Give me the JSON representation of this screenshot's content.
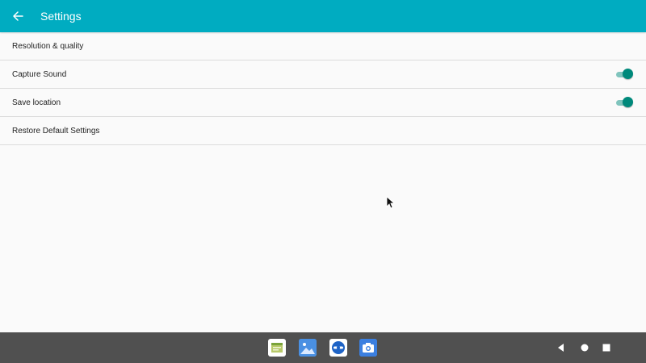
{
  "app_bar": {
    "title": "Settings",
    "back_icon": "arrow-back-icon",
    "color": "#00acc1"
  },
  "settings": [
    {
      "label": "Resolution & quality",
      "has_toggle": false
    },
    {
      "label": "Capture Sound",
      "has_toggle": true,
      "toggle_on": true
    },
    {
      "label": "Save location",
      "has_toggle": true,
      "toggle_on": true
    },
    {
      "label": "Restore Default Settings",
      "has_toggle": false
    }
  ],
  "toggle_color": "#00897b",
  "dock": {
    "apps": [
      {
        "icon": "files-app-icon"
      },
      {
        "icon": "gallery-app-icon"
      },
      {
        "icon": "browser-app-icon"
      },
      {
        "icon": "camera-app-icon"
      }
    ]
  },
  "nav": {
    "back_icon": "nav-back-icon",
    "home_icon": "nav-home-icon",
    "recents_icon": "nav-recents-icon"
  }
}
